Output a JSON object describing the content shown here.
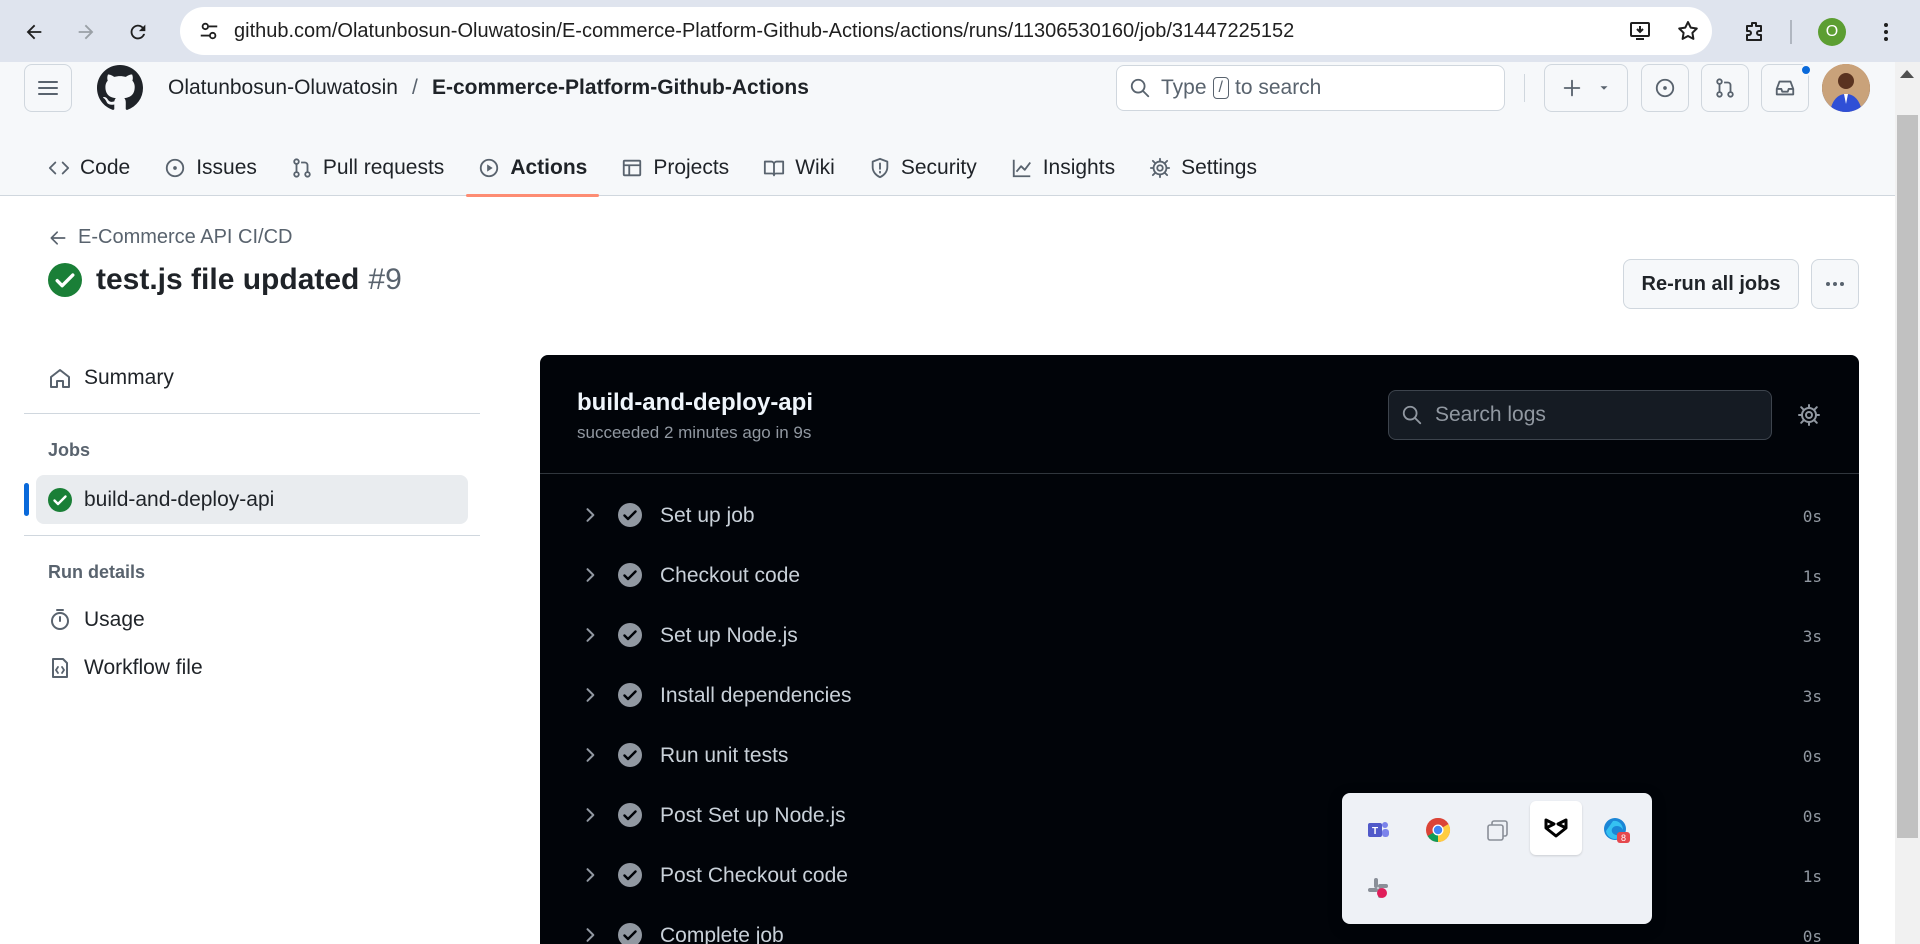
{
  "browser": {
    "url": "github.com/Olatunbosun-Oluwatosin/E-commerce-Platform-Github-Actions/actions/runs/11306530160/job/31447225152",
    "profile_initial": "O"
  },
  "header": {
    "owner": "Olatunbosun-Oluwatosin",
    "separator": "/",
    "repo": "E-commerce-Platform-Github-Actions",
    "search_prefix": "Type",
    "search_key": "/",
    "search_suffix": "to search"
  },
  "tabs": [
    {
      "label": "Code",
      "icon": "code-icon"
    },
    {
      "label": "Issues",
      "icon": "issue-icon"
    },
    {
      "label": "Pull requests",
      "icon": "pull-request-icon"
    },
    {
      "label": "Actions",
      "icon": "play-icon",
      "active": true
    },
    {
      "label": "Projects",
      "icon": "table-icon"
    },
    {
      "label": "Wiki",
      "icon": "book-icon"
    },
    {
      "label": "Security",
      "icon": "shield-icon"
    },
    {
      "label": "Insights",
      "icon": "graph-icon"
    },
    {
      "label": "Settings",
      "icon": "gear-icon"
    }
  ],
  "run": {
    "workflow_name": "E-Commerce API CI/CD",
    "title": "test.js file updated",
    "number": "#9",
    "rerun_label": "Re-run all jobs"
  },
  "sidebar": {
    "summary": "Summary",
    "jobs_heading": "Jobs",
    "job": "build-and-deploy-api",
    "run_details_heading": "Run details",
    "usage": "Usage",
    "workflow_file": "Workflow file"
  },
  "log": {
    "job_name": "build-and-deploy-api",
    "status": "succeeded 2 minutes ago in 9s",
    "search_placeholder": "Search logs",
    "steps": [
      {
        "name": "Set up job",
        "time": "0s"
      },
      {
        "name": "Checkout code",
        "time": "1s"
      },
      {
        "name": "Set up Node.js",
        "time": "3s"
      },
      {
        "name": "Install dependencies",
        "time": "3s"
      },
      {
        "name": "Run unit tests",
        "time": "0s"
      },
      {
        "name": "Post Set up Node.js",
        "time": "0s"
      },
      {
        "name": "Post Checkout code",
        "time": "1s"
      },
      {
        "name": "Complete job",
        "time": "0s"
      }
    ]
  },
  "tray": {
    "icons": [
      "teams-icon",
      "chrome-icon",
      "task-view-icon",
      "capcut-icon",
      "edge-icon",
      "slack-icon"
    ],
    "edge_badge": "8"
  },
  "colors": {
    "success": "#1a7f37",
    "accent_underline": "#fd8c73",
    "link_blue": "#0969da",
    "log_bg": "#010409"
  }
}
